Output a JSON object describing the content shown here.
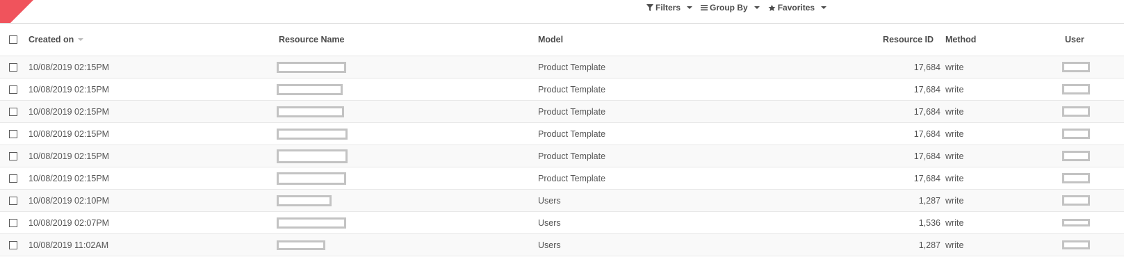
{
  "search": {
    "filters_label": "Filters",
    "group_by_label": "Group By",
    "favorites_label": "Favorites"
  },
  "columns": {
    "created_on": "Created on",
    "resource_name": "Resource Name",
    "model": "Model",
    "resource_id": "Resource ID",
    "method": "Method",
    "user": "User"
  },
  "rows": [
    {
      "created_on": "10/08/2019 02:15PM",
      "model": "Product Template",
      "resource_id": "17,684",
      "method": "write"
    },
    {
      "created_on": "10/08/2019 02:15PM",
      "model": "Product Template",
      "resource_id": "17,684",
      "method": "write"
    },
    {
      "created_on": "10/08/2019 02:15PM",
      "model": "Product Template",
      "resource_id": "17,684",
      "method": "write"
    },
    {
      "created_on": "10/08/2019 02:15PM",
      "model": "Product Template",
      "resource_id": "17,684",
      "method": "write"
    },
    {
      "created_on": "10/08/2019 02:15PM",
      "model": "Product Template",
      "resource_id": "17,684",
      "method": "write"
    },
    {
      "created_on": "10/08/2019 02:15PM",
      "model": "Product Template",
      "resource_id": "17,684",
      "method": "write"
    },
    {
      "created_on": "10/08/2019 02:10PM",
      "model": "Users",
      "resource_id": "1,287",
      "method": "write"
    },
    {
      "created_on": "10/08/2019 02:07PM",
      "model": "Users",
      "resource_id": "1,536",
      "method": "write"
    },
    {
      "created_on": "10/08/2019 11:02AM",
      "model": "Users",
      "resource_id": "1,287",
      "method": "write"
    }
  ]
}
